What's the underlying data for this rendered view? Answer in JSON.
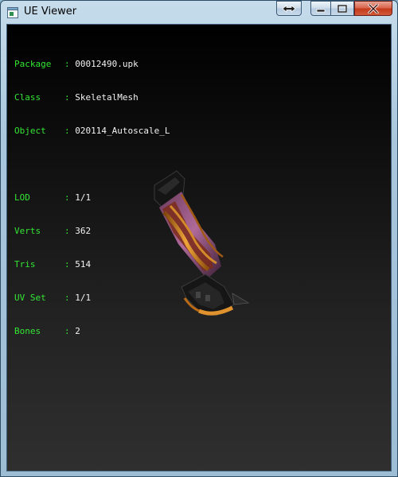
{
  "window": {
    "title": "UE Viewer",
    "icon": "app-window-icon",
    "controls": [
      "swap-icon",
      "minimize-icon",
      "maximize-icon",
      "close-icon"
    ]
  },
  "info": {
    "package": {
      "label": "Package",
      "value": "00012490.upk"
    },
    "class": {
      "label": "Class",
      "value": "SkeletalMesh"
    },
    "object": {
      "label": "Object",
      "value": "020114_Autoscale_L"
    },
    "lod": {
      "label": "LOD",
      "value": "1/1"
    },
    "verts": {
      "label": "Verts",
      "value": "362"
    },
    "tris": {
      "label": "Tris",
      "value": "514"
    },
    "uvset": {
      "label": "UV Set",
      "value": "1/1"
    },
    "bones": {
      "label": "Bones",
      "value": "2"
    }
  },
  "colors": {
    "label": "#33e633",
    "value": "#f2f2f2",
    "viewport_bg": "#000000"
  }
}
